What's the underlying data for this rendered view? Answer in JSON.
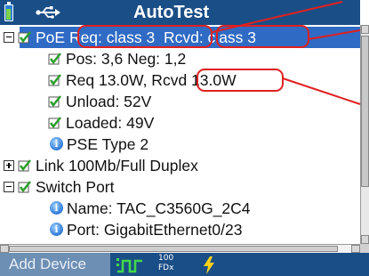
{
  "titlebar": {
    "title": "AutoTest",
    "battery_icon": "battery-icon",
    "usb_icon": "usb-icon"
  },
  "tree": {
    "rows": [
      {
        "kind": "expander-minus",
        "check": true,
        "label": "PoE Req: class 3  Rcvd: class 3",
        "selected": true
      },
      {
        "kind": "check",
        "label": "Pos: 3,6 Neg: 1,2"
      },
      {
        "kind": "check",
        "label": "Req 13.0W, Rcvd 13.0W"
      },
      {
        "kind": "check",
        "label": "Unload: 52V"
      },
      {
        "kind": "check",
        "label": "Loaded: 49V"
      },
      {
        "kind": "info",
        "label": "PSE Type 2"
      },
      {
        "kind": "expander-plus",
        "check": true,
        "label": "Link 100Mb/Full Duplex"
      },
      {
        "kind": "expander-minus",
        "check": true,
        "label": "Switch Port"
      },
      {
        "kind": "info",
        "label": "Name: TAC_C3560G_2C4"
      },
      {
        "kind": "info",
        "label": "Port: GigabitEthernet0/23"
      }
    ]
  },
  "statusbar": {
    "add_device": "Add Device",
    "fdx_speed": "100",
    "fdx_label": "FDx",
    "link_icon": "link-pulse-icon",
    "poe_icon": "lightning-bolt-icon"
  },
  "colors": {
    "titlebar": "#1a4e86",
    "selection": "#2f6bc4",
    "check_green": "#2ea02e",
    "annotation_red": "#e02020",
    "bolt": "#ffd21a"
  }
}
